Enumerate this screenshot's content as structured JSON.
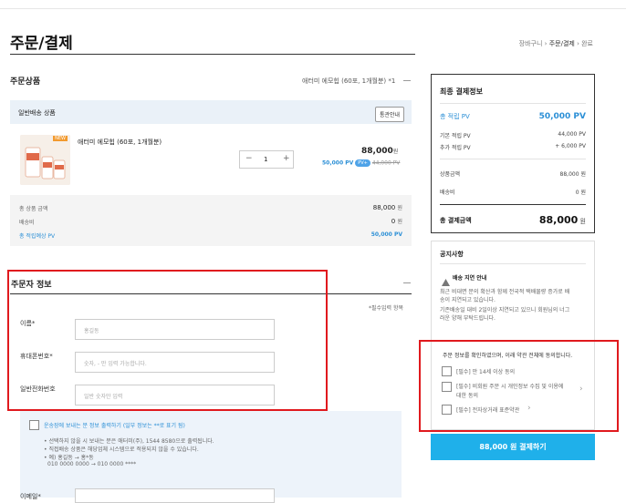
{
  "page": {
    "title": "주문/결제"
  },
  "breadcrumb": {
    "cart": "장바구니",
    "sep": "›",
    "order": "주문/결제",
    "done": "완료"
  },
  "product_section": {
    "title": "주문상품",
    "summary": "애터미 에모힙 (60포, 1개월분) *1",
    "delivery_label": "일반배송 상품",
    "notice_button": "통관안내",
    "item": {
      "badge": "NEW",
      "name": "애터미 에모힙 (60포, 1개월분)",
      "qty": "1",
      "minus": "−",
      "plus": "+",
      "price": "88,000",
      "won": "원",
      "pv": "50,000 PV",
      "pv_chip": "PV+",
      "old_price": "44,000 PV"
    },
    "summary_box": {
      "total_label": "총 상품 금액",
      "total_value": "88,000",
      "ship_label": "배송비",
      "ship_value": "0",
      "pv_label": "총 적립예상 PV",
      "pv_value": "50,000 PV",
      "won": "원"
    }
  },
  "orderer": {
    "title": "주문자 정보",
    "required_note": "*필수입력 항목",
    "name_label": "이름*",
    "name_placeholder": "홍길동",
    "phone_label": "휴대폰번호*",
    "phone_placeholder": "숫자, - 만 입력 가능합니다.",
    "tel_label": "일반전화번호",
    "tel_placeholder": "일반 숫자만 입력"
  },
  "shipping_note": {
    "checkbox_label": "운송장에 보내는 분 정보 출력하기 (일부 정보는 **로 표기 됨)",
    "line1": "• 선택하지 않을 시 보내는 분은 애터미(주), 1544 8580으로 출력됩니다.",
    "line2": "• 직접배송 상품은 해당업체 시스템으로 적용되지 않을 수 있습니다.",
    "line3": "• 예) 홍길동 → 홍*동",
    "line4": "010 0000 0000 → 010 0000 ****",
    "next_label": "이메일*"
  },
  "payment_panel": {
    "title": "최종 결제정보",
    "total_pv_label": "총 적립 PV",
    "total_pv_value": "50,000 PV",
    "base_pv_label": "기본 적립 PV",
    "base_pv_value": "44,000 PV",
    "add_pv_label": "추가 적립 PV",
    "add_pv_value": "+ 6,000 PV",
    "goods_label": "상품금액",
    "goods_value": "88,000",
    "ship_label": "배송비",
    "ship_value": "0",
    "final_label": "총 결제금액",
    "final_value": "88,000",
    "won": "원"
  },
  "notice": {
    "title": "공지사항",
    "subtitle": "배송 지연 안내",
    "body1": "최근 비대면 문의 확산과 함께 전국적 택배물량 증가로 배",
    "body2": "송이 지연되고 있습니다.",
    "body3": "기존배송일 대비 2일이상 지연되고 있으니 회원님의 너그",
    "body4": "러운 양해 부탁드립니다."
  },
  "agreements": {
    "intro": "주문 정보를 확인하였으며, 이래 약관 전체에 동의합니다.",
    "item1": "[필수] 만 14세 이상 동의",
    "item2a": "[필수] 비회원 주문 시 개인정보 수집 및 이용에",
    "item2b": "대한 동의",
    "item3": "[필수] 전자상거래 표준약관",
    "chevron": "›"
  },
  "pay_button": {
    "label": "88,000 원 결제하기"
  },
  "colors": {
    "accent": "#2b8fd6",
    "pay": "#1fb0ea",
    "highlight": "#e0191e"
  }
}
